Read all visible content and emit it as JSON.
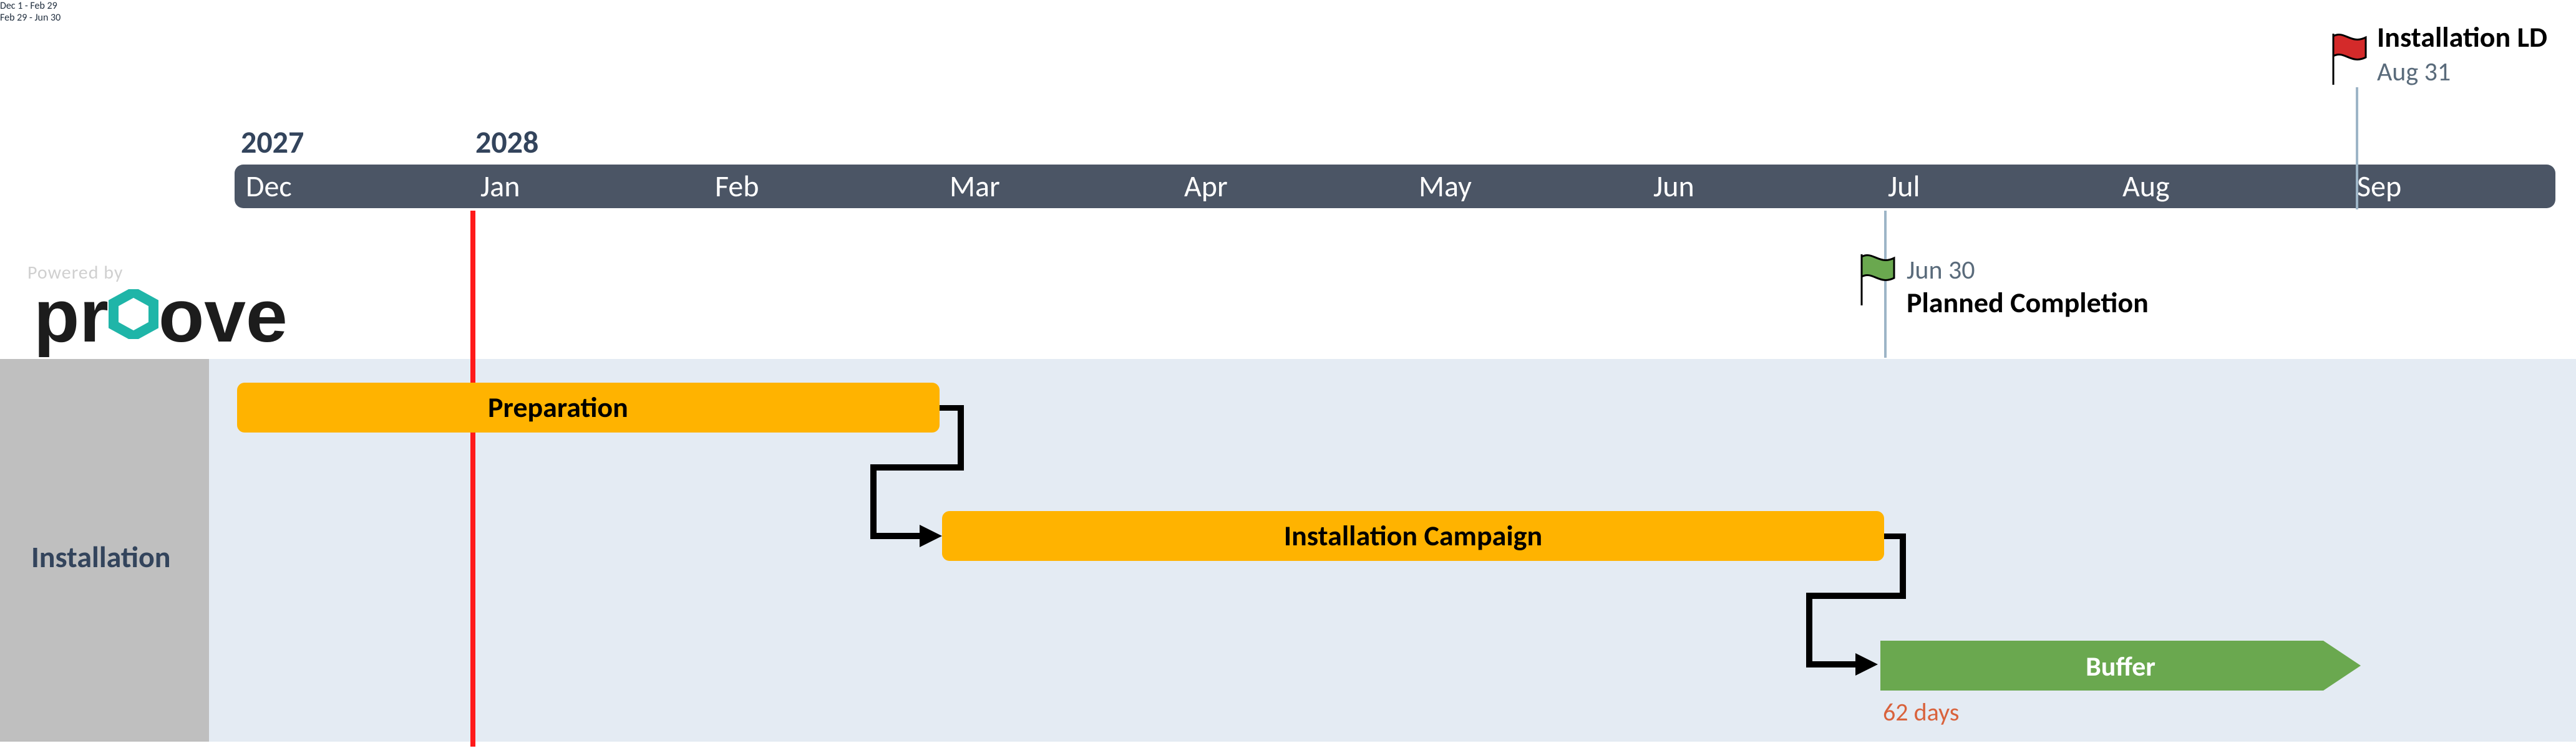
{
  "section": {
    "name": "Installation"
  },
  "years": {
    "y2027": "2027",
    "y2028": "2028"
  },
  "months": {
    "dec": "Dec",
    "jan": "Jan",
    "feb": "Feb",
    "mar": "Mar",
    "apr": "Apr",
    "may": "May",
    "jun": "Jun",
    "jul": "Jul",
    "aug": "Aug",
    "sep": "Sep"
  },
  "tasks": {
    "prep": {
      "label": "Preparation",
      "dates": "Dec 1 - Feb 29"
    },
    "camp": {
      "label": "Installation Campaign",
      "dates": "Feb 29 - Jun 30"
    },
    "buffer": {
      "label": "Buffer",
      "duration": "62 days"
    }
  },
  "milestones": {
    "planned": {
      "title": "Planned Completion",
      "date": "Jun 30"
    },
    "ld": {
      "title": "Installation LD",
      "date": "Aug 31"
    }
  },
  "branding": {
    "powered": "Powered by",
    "logo": "proove"
  },
  "chart_data": {
    "type": "bar",
    "title": "Installation schedule (Gantt)",
    "xaxis": {
      "start": "2027-12-01",
      "end": "2028-09-05",
      "months": [
        "Dec",
        "Jan",
        "Feb",
        "Mar",
        "Apr",
        "May",
        "Jun",
        "Jul",
        "Aug",
        "Sep"
      ],
      "year_breaks": [
        {
          "label": "2027",
          "at": "2027-12-01"
        },
        {
          "label": "2028",
          "at": "2028-01-01"
        }
      ]
    },
    "section": "Installation",
    "today_marker": "2027-12-31",
    "tasks": [
      {
        "name": "Preparation",
        "start": "2027-12-01",
        "end": "2028-02-29",
        "color": "#ffb300"
      },
      {
        "name": "Installation Campaign",
        "start": "2028-02-29",
        "end": "2028-06-30",
        "color": "#ffb300",
        "depends_on": "Preparation"
      },
      {
        "name": "Buffer",
        "start": "2028-07-01",
        "end": "2028-08-31",
        "color": "#6aa84f",
        "duration_days": 62,
        "depends_on": "Installation Campaign",
        "shape": "arrow"
      }
    ],
    "milestones": [
      {
        "name": "Planned Completion",
        "date": "2028-06-30",
        "flag_color": "#6aa84f"
      },
      {
        "name": "Installation LD",
        "date": "2028-08-31",
        "flag_color": "#d42a2a"
      }
    ]
  }
}
